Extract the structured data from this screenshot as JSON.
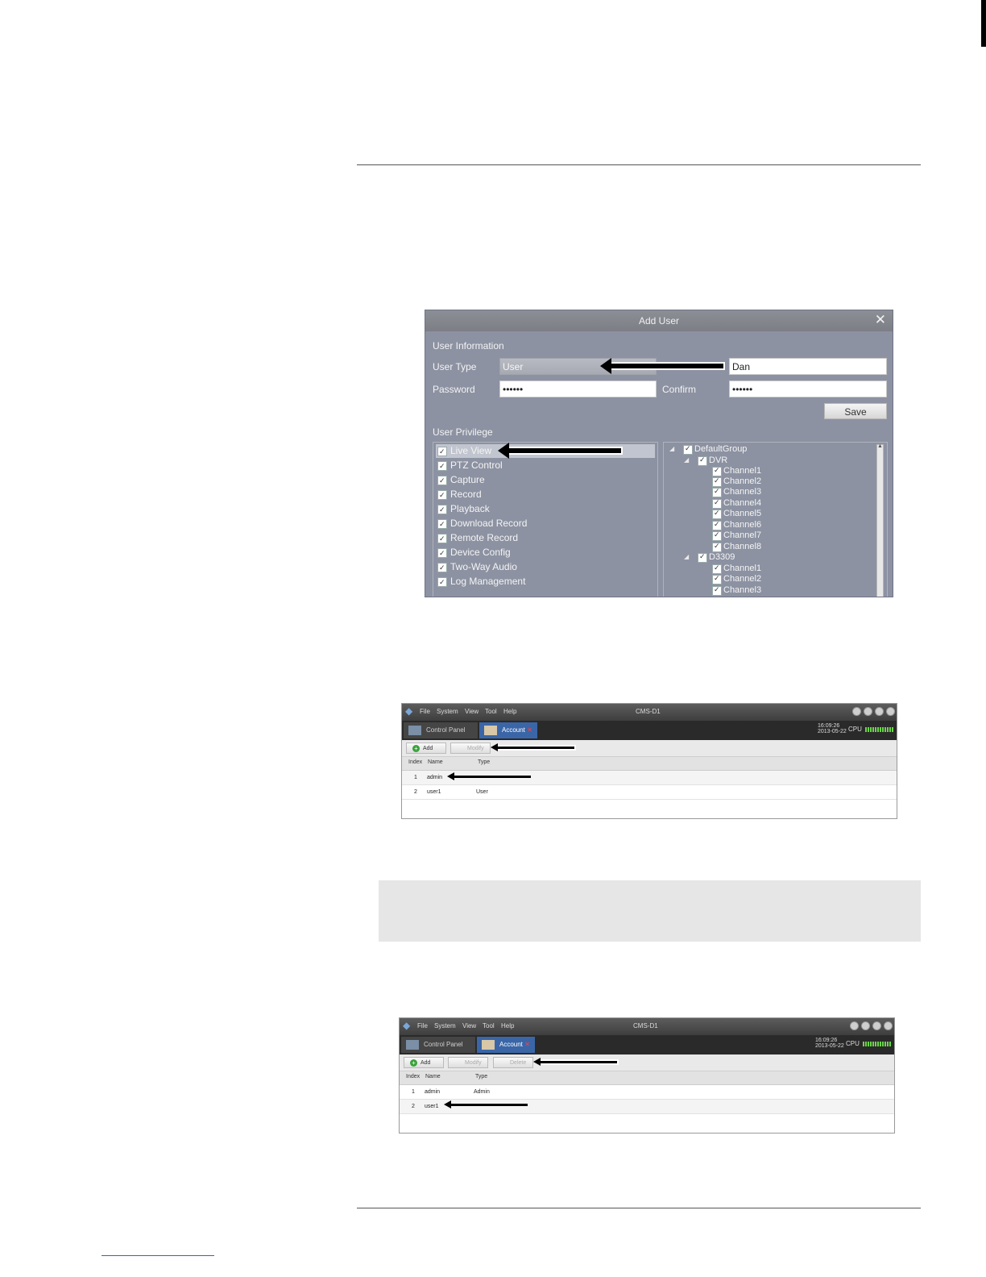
{
  "add_user_dialog": {
    "title": "Add User",
    "close_glyph": "✕",
    "section_user_info": "User Information",
    "user_type_label": "User Type",
    "user_type_value": "User",
    "name_value": "Dan",
    "password_label": "Password",
    "password_value": "••••••",
    "confirm_label": "Confirm",
    "confirm_value": "••••••",
    "save_label": "Save",
    "section_privilege": "User Privilege",
    "privileges": [
      "Live View",
      "PTZ Control",
      "Capture",
      "Record",
      "Playback",
      "Download Record",
      "Remote Record",
      "Device Config",
      "Two-Way Audio",
      "Log Management"
    ],
    "tree": {
      "root": "DefaultGroup",
      "dvr": "DVR",
      "dvr_channels": [
        "Channel1",
        "Channel2",
        "Channel3",
        "Channel4",
        "Channel5",
        "Channel6",
        "Channel7",
        "Channel8"
      ],
      "device2": "D3309",
      "device2_channels": [
        "Channel1",
        "Channel2",
        "Channel3"
      ]
    }
  },
  "account_window_1": {
    "menu": [
      "File",
      "System",
      "View",
      "Tool",
      "Help"
    ],
    "app_title": "CMS-D1",
    "tab_control_panel": "Control Panel",
    "tab_account": "Account",
    "tab_close": "✕",
    "time": "16:09:26",
    "date": "2013-05-22",
    "cpu_label": "CPU",
    "add_label": "Add",
    "modify_label": "Modify",
    "columns": [
      "Index",
      "Name",
      "Type"
    ],
    "rows": [
      {
        "index": "1",
        "name": "admin",
        "type": ""
      },
      {
        "index": "2",
        "name": "user1",
        "type": "User"
      }
    ]
  },
  "account_window_2": {
    "menu": [
      "File",
      "System",
      "View",
      "Tool",
      "Help"
    ],
    "app_title": "CMS-D1",
    "tab_control_panel": "Control Panel",
    "tab_account": "Account",
    "tab_close": "✕",
    "time": "16:09:26",
    "date": "2013-05-22",
    "cpu_label": "CPU",
    "add_label": "Add",
    "modify_label": "Modify",
    "delete_label": "Delete",
    "columns": [
      "Index",
      "Name",
      "Type"
    ],
    "rows": [
      {
        "index": "1",
        "name": "admin",
        "type": "Admin"
      },
      {
        "index": "2",
        "name": "user1",
        "type": ""
      }
    ]
  }
}
